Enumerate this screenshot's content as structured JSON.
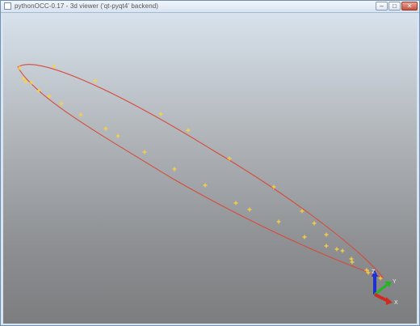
{
  "window": {
    "title": "pythonOCC-0.17 - 3d viewer ('qt-pyqt4' backend)",
    "buttons": {
      "minimize": "–",
      "maximize": "□",
      "close": "✕"
    }
  },
  "viewport": {
    "background_top": "#d8e2ec",
    "background_bottom": "#7c7d7f",
    "curve_color": "#d84a3a",
    "point_color": "#ffd23c"
  },
  "trihedron": {
    "axes": [
      {
        "label": "Z",
        "color": "#1f2fd0"
      },
      {
        "label": "Y",
        "color": "#22b51f"
      },
      {
        "label": "X",
        "color": "#d02a1f"
      }
    ]
  }
}
